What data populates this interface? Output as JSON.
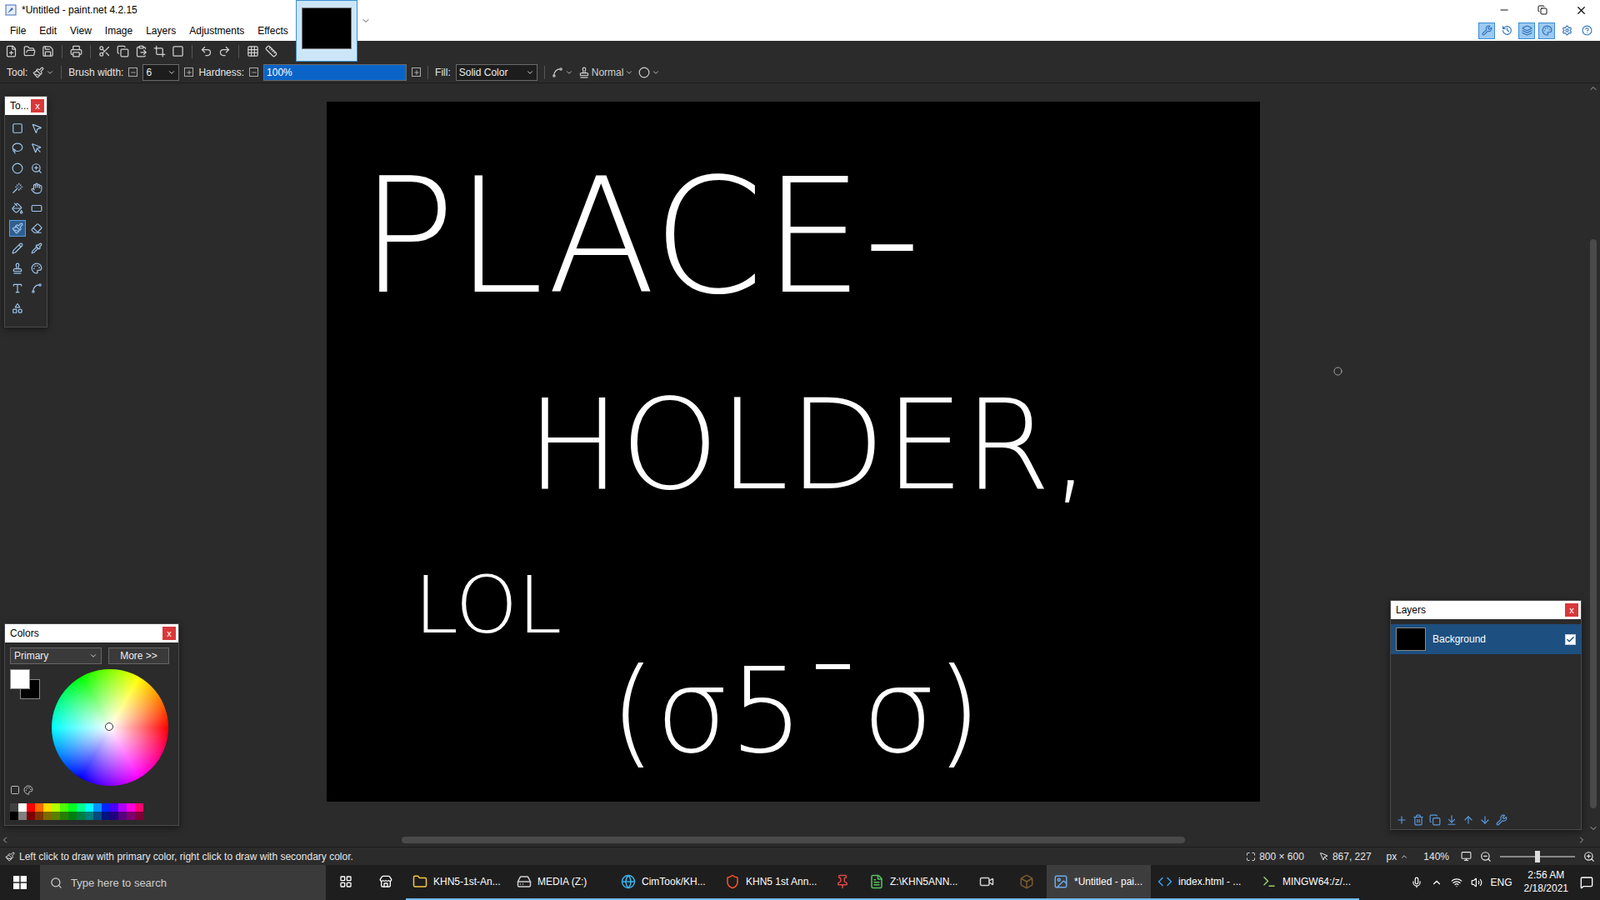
{
  "window": {
    "title": "*Untitled - paint.net 4.2.15"
  },
  "menu": [
    "File",
    "Edit",
    "View",
    "Image",
    "Layers",
    "Adjustments",
    "Effects"
  ],
  "image_tabs": [
    {
      "selected": true
    }
  ],
  "panel_toggles": [
    {
      "selected": true
    },
    {
      "selected": false
    },
    {
      "selected": true
    },
    {
      "selected": true
    }
  ],
  "tool_options": {
    "tool_label": "Tool:",
    "brush_width_label": "Brush width:",
    "brush_width": "6",
    "hardness_label": "Hardness:",
    "hardness": "100%",
    "hardness_level": 1,
    "fill_label": "Fill:",
    "fill": "Solid Color",
    "blend_mode": "Normal"
  },
  "tools_panel": {
    "title": "To...",
    "close": "x",
    "tools": [
      {
        "selected": false
      },
      {
        "selected": false
      },
      {
        "selected": false
      },
      {
        "selected": false
      },
      {
        "selected": false
      },
      {
        "selected": false
      },
      {
        "selected": false
      },
      {
        "selected": false
      },
      {
        "selected": false
      },
      {
        "selected": false
      },
      {
        "selected": true
      },
      {
        "selected": false
      },
      {
        "selected": false
      },
      {
        "selected": false
      },
      {
        "selected": false
      },
      {
        "selected": false
      },
      {
        "selected": false
      },
      {
        "selected": false
      },
      {
        "selected": false
      }
    ]
  },
  "canvas": {
    "lines": [
      "PLACE-",
      "HOLDER,",
      "LOL",
      "(σ5¯σ)"
    ]
  },
  "colors_panel": {
    "title": "Colors",
    "close": "x",
    "mode": "Primary",
    "more": "More >>",
    "primary_color": "#ffffff",
    "secondary_color": "#000000",
    "palette": [
      [
        {
          "color": "#404040"
        },
        {
          "color": "#ffffff"
        },
        {
          "color": "#ff0000"
        },
        {
          "color": "#ff6a00"
        },
        {
          "color": "#ffd800"
        },
        {
          "color": "#b6ff00"
        },
        {
          "color": "#4cff00"
        },
        {
          "color": "#00ff21"
        },
        {
          "color": "#00ff90"
        },
        {
          "color": "#00ffff"
        },
        {
          "color": "#0094ff"
        },
        {
          "color": "#0026ff"
        },
        {
          "color": "#4800ff"
        },
        {
          "color": "#b200ff"
        },
        {
          "color": "#ff00dc"
        },
        {
          "color": "#ff006e"
        }
      ],
      [
        {
          "color": "#000000"
        },
        {
          "color": "#808080"
        },
        {
          "color": "#7f0000"
        },
        {
          "color": "#7f3300"
        },
        {
          "color": "#7f6a00"
        },
        {
          "color": "#5b7f00"
        },
        {
          "color": "#267f00"
        },
        {
          "color": "#007f0e"
        },
        {
          "color": "#007f46"
        },
        {
          "color": "#007f7f"
        },
        {
          "color": "#004a7f"
        },
        {
          "color": "#00137f"
        },
        {
          "color": "#21007f"
        },
        {
          "color": "#57007f"
        },
        {
          "color": "#7f006e"
        },
        {
          "color": "#7f0037"
        }
      ]
    ]
  },
  "layers_panel": {
    "title": "Layers",
    "close": "x",
    "layers": [
      {
        "name": "Background",
        "selected": true,
        "visible": true
      }
    ]
  },
  "scrollbars": {
    "horizontal": {
      "start": 0.25,
      "size": 0.5
    },
    "vertical": {
      "start": 0.2,
      "size": 0.78
    }
  },
  "status_bar": {
    "hint": "Left click to draw with primary color, right click to draw with secondary color.",
    "image_size": "800 × 600",
    "cursor": "867, 227",
    "unit": "px",
    "zoom": "140%",
    "zoom_level": 0.5
  },
  "taskbar": {
    "search_placeholder": "Type here to search",
    "items": [
      {
        "kind": "app",
        "label": "KHN5-1st-An...",
        "selected": false
      },
      {
        "kind": "app",
        "label": "MEDIA (Z:)",
        "selected": false
      },
      {
        "kind": "app",
        "label": "CimTook/KH...",
        "selected": false
      },
      {
        "kind": "app",
        "label": "KHN5 1st Ann...",
        "selected": false
      },
      {
        "kind": "icon",
        "selected": false
      },
      {
        "kind": "app",
        "label": "Z:\\KHN5ANN...",
        "selected": false
      },
      {
        "kind": "icon",
        "selected": false
      },
      {
        "kind": "icon",
        "selected": false
      },
      {
        "kind": "app",
        "label": "*Untitled - pai...",
        "selected": true
      },
      {
        "kind": "app",
        "label": "index.html - ...",
        "selected": false
      },
      {
        "kind": "app",
        "label": "MINGW64:/z/...",
        "selected": false
      }
    ],
    "language": "ENG",
    "time": "2:56 AM",
    "date": "2/18/2021"
  }
}
